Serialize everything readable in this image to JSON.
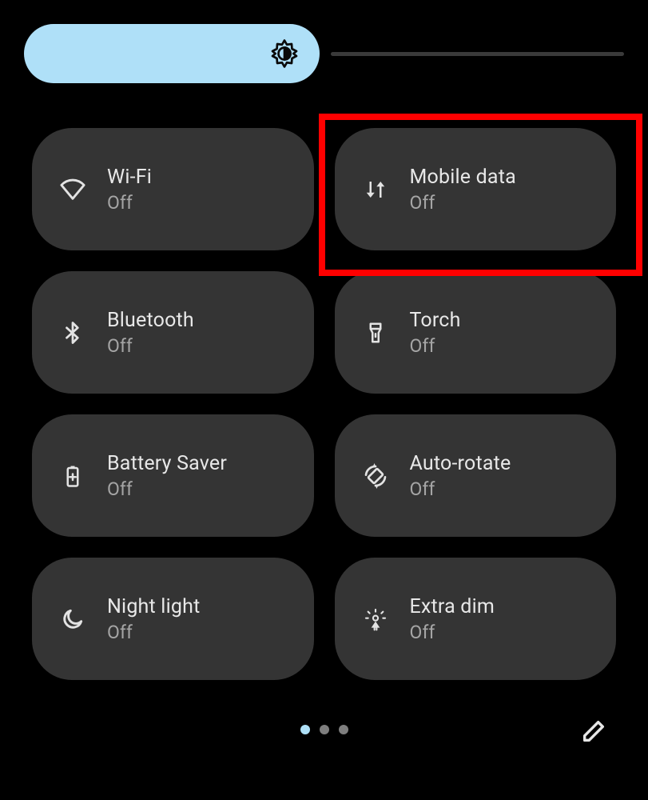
{
  "brightness": {
    "icon": "auto-brightness-icon"
  },
  "tiles": [
    {
      "id": "wifi",
      "label": "Wi-Fi",
      "status": "Off",
      "icon": "wifi-icon"
    },
    {
      "id": "mobile-data",
      "label": "Mobile data",
      "status": "Off",
      "icon": "mobile-data-icon",
      "highlighted": true
    },
    {
      "id": "bluetooth",
      "label": "Bluetooth",
      "status": "Off",
      "icon": "bluetooth-icon"
    },
    {
      "id": "torch",
      "label": "Torch",
      "status": "Off",
      "icon": "torch-icon"
    },
    {
      "id": "battery-saver",
      "label": "Battery Saver",
      "status": "Off",
      "icon": "battery-saver-icon"
    },
    {
      "id": "auto-rotate",
      "label": "Auto-rotate",
      "status": "Off",
      "icon": "auto-rotate-icon"
    },
    {
      "id": "night-light",
      "label": "Night light",
      "status": "Off",
      "icon": "night-light-icon"
    },
    {
      "id": "extra-dim",
      "label": "Extra dim",
      "status": "Off",
      "icon": "extra-dim-icon"
    }
  ],
  "pager": {
    "pages": 3,
    "active": 0
  },
  "colors": {
    "accent": "#afe0f8",
    "tile_bg": "#343434",
    "highlight": "#ff0000"
  }
}
